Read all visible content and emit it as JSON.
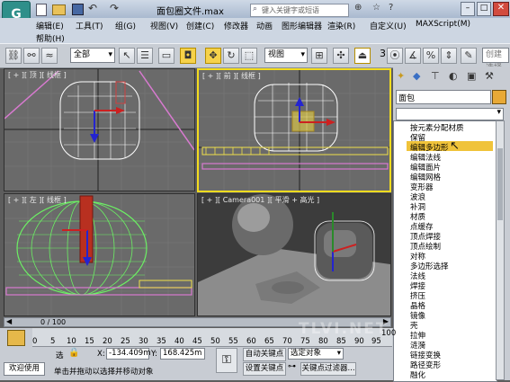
{
  "window": {
    "title": "面包圈文件.max",
    "search_placeholder": "键入关键字或短语"
  },
  "menu": {
    "row1": [
      "编辑(E)",
      "工具(T)",
      "组(G)",
      "视图(V)",
      "创建(C)",
      "修改器",
      "动画",
      "图形编辑器",
      "渲染(R)",
      "自定义(U)",
      "MAXScript(M)"
    ],
    "row2": [
      "帮助(H)"
    ]
  },
  "toolbar": {
    "selection_filter": "全部",
    "reference_coord": "视图",
    "snap_value": "3",
    "named_selection_placeholder": "创建选择"
  },
  "viewports": {
    "top_left_label": "[ + ][ 顶 ][ 线框 ]",
    "top_right_label": "[ + ][ 前 ][ 线框 ]",
    "bottom_left_label": "[ + ][ 左 ][ 线框 ]",
    "bottom_right_label": "[ + ][ Camera001 ][ 平滑 + 高光 ]"
  },
  "command_panel": {
    "object_name": "面包",
    "modifier_list": [
      "按元素分配材质",
      "保留",
      "编辑多边形",
      "编辑法线",
      "编辑面片",
      "编辑网格",
      "变形器",
      "波浪",
      "补洞",
      "材质",
      "点缓存",
      "顶点焊接",
      "顶点绘制",
      "对称",
      "多边形选择",
      "法线",
      "焊接",
      "挤压",
      "晶格",
      "镜像",
      "壳",
      "拉伸",
      "涟漪",
      "链接变换",
      "路径变形",
      "融化"
    ],
    "selected_index": 2
  },
  "timeline": {
    "frame_counter": "0 / 100",
    "ticks": [
      "0",
      "5",
      "10",
      "15",
      "20",
      "25",
      "30",
      "35",
      "40",
      "45",
      "50",
      "55",
      "60",
      "65",
      "70",
      "75",
      "80",
      "85",
      "90",
      "95",
      "100"
    ]
  },
  "status": {
    "selection_info": "选",
    "x_label": "X:",
    "x_value": "-134.409m",
    "y_label": "Y:",
    "y_value": "168.425m",
    "auto_key": "自动关键点",
    "set_key": "设置关键点",
    "key_mode": "选定对象",
    "key_filters": "关键点过滤器...",
    "welcome": "欢迎使用",
    "prompt": "单击并拖动以选择并移动对象"
  },
  "watermark": "TLVI.NET",
  "colors": {
    "active_border": "#f3dc1e",
    "highlight": "#f0c33a",
    "viewport_bg": "#6a6a6a"
  }
}
